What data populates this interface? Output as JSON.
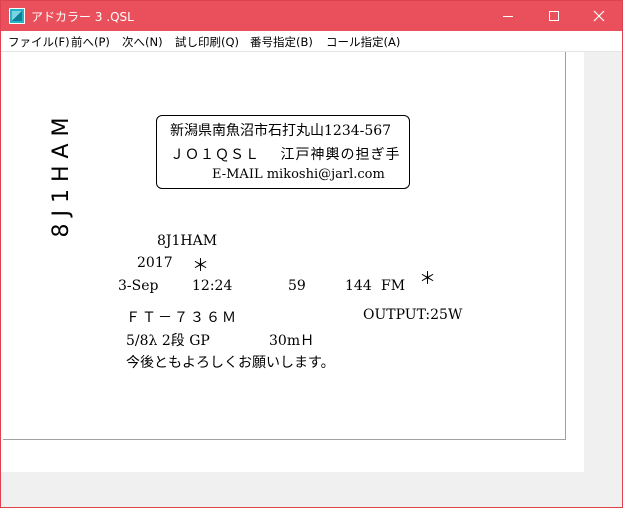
{
  "window": {
    "title": "アドカラー 3 .QSL",
    "minimize_glyph": "—",
    "colors": {
      "titlebar": "#e9505b",
      "border": "#e0414f"
    }
  },
  "menu": [
    {
      "label": "ファイル(F)"
    },
    {
      "label": "前へ(P)"
    },
    {
      "label": "次へ(N)"
    },
    {
      "label": "試し印刷(Q)"
    },
    {
      "label": "番号指定(B)"
    },
    {
      "label": "コール指定(A)"
    }
  ],
  "card": {
    "vertical_callsign": "8J1HAM",
    "address": {
      "line1": "新潟県南魚沼市石打丸山1234-567",
      "line2": "ＪＯ１ＱＳＬ　 江戸神輿の担ぎ手",
      "line3": "E-MAIL  mikoshi@jarl.com"
    },
    "to_callsign": "8J1HAM",
    "year": "2017",
    "year_mark": "＊",
    "date": "3-Sep",
    "time": "12:24",
    "rst": "59",
    "band": "144",
    "mode": "FM",
    "right_mark": "＊",
    "rig": "ＦＴ－７３６Ｍ",
    "output": "OUTPUT:25W",
    "antenna": "5/8λ 2段 GP",
    "height": "30mＨ",
    "message": "今後ともよろしくお願いします。"
  }
}
